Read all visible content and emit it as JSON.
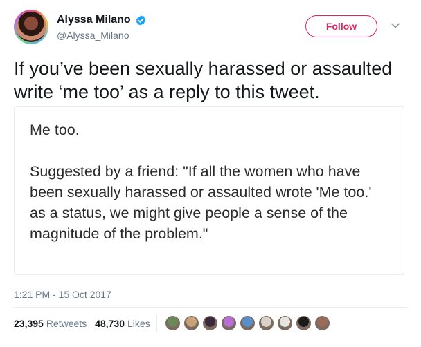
{
  "user": {
    "display_name": "Alyssa Milano",
    "handle": "@Alyssa_Milano",
    "verified": true
  },
  "actions": {
    "follow_label": "Follow"
  },
  "tweet": {
    "text": "If you’ve been sexually harassed or assaulted write ‘me too’ as a reply to this tweet.",
    "media_text": "Me too.\n\nSuggested by a friend: \"If all the women who have been sexually harassed or assaulted wrote 'Me too.' as a status, we might give people a sense of the magnitude of the problem.\"",
    "timestamp": "1:21 PM - 15 Oct 2017"
  },
  "stats": {
    "retweets_count": "23,395",
    "retweets_label": "Retweets",
    "likes_count": "48,730",
    "likes_label": "Likes"
  },
  "colors": {
    "follow_accent": "#e0245e",
    "verified": "#1da1f2",
    "muted_text": "#657786"
  },
  "liker_avatars": [
    {
      "color": "#6a8a5a"
    },
    {
      "color": "#c9a27a"
    },
    {
      "color": "#3a2a3a"
    },
    {
      "color": "#b76fd0"
    },
    {
      "color": "#5a8ec9"
    },
    {
      "color": "#d9d2c8"
    },
    {
      "color": "#e8e4df"
    },
    {
      "color": "#1a1a1a"
    },
    {
      "color": "#9a6a5a"
    }
  ]
}
